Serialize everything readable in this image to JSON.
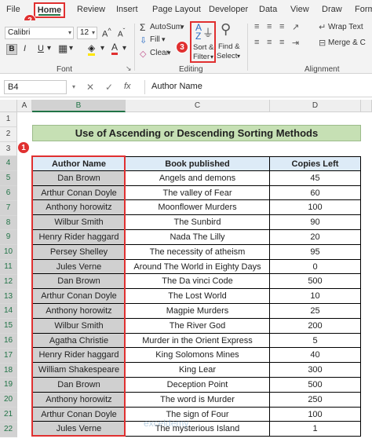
{
  "ribbon_tabs": [
    "File",
    "Home",
    "Review",
    "Insert",
    "Page Layout",
    "Developer",
    "Data",
    "View",
    "Draw",
    "Form"
  ],
  "ribbon": {
    "font_name": "Calibri",
    "font_size": "12",
    "autosum_label": "AutoSum",
    "fill_label": "Fill",
    "clear_label": "Clear",
    "sort_filter_label_1": "Sort &",
    "sort_filter_label_2": "Filter",
    "find_select_label_1": "Find &",
    "find_select_label_2": "Select",
    "wrap_text_label": "Wrap Text",
    "merge_label": "Merge & C",
    "group_font": "Font",
    "group_editing": "Editing",
    "group_alignment": "Alignment"
  },
  "badges": [
    "1",
    "2",
    "3"
  ],
  "formula_bar": {
    "name_box": "B4",
    "content": "Author Name"
  },
  "columns": [
    "A",
    "B",
    "C",
    "D"
  ],
  "rows": [
    "1",
    "2",
    "3",
    "4",
    "5",
    "6",
    "7",
    "8",
    "9",
    "10",
    "11",
    "12",
    "13",
    "14",
    "15",
    "16",
    "17",
    "18",
    "19",
    "20",
    "21",
    "22"
  ],
  "table": {
    "title": "Use of Ascending or Descending Sorting Methods",
    "headers": [
      "Author Name",
      "Book published",
      "Copies Left"
    ],
    "rows": [
      [
        "Dan Brown",
        "Angels and demons",
        "45"
      ],
      [
        "Arthur Conan Doyle",
        "The valley of Fear",
        "60"
      ],
      [
        "Anthony horowitz",
        "Moonflower Murders",
        "100"
      ],
      [
        "Wilbur Smith",
        "The Sunbird",
        "90"
      ],
      [
        "Henry Rider haggard",
        "Nada The Lilly",
        "20"
      ],
      [
        "Persey Shelley",
        "The necessity of atheism",
        "95"
      ],
      [
        "Jules Verne",
        "Around The World in Eighty Days",
        "0"
      ],
      [
        "Dan Brown",
        "The Da vinci Code",
        "500"
      ],
      [
        "Arthur Conan Doyle",
        "The Lost World",
        "10"
      ],
      [
        "Anthony horowitz",
        "Magpie Murders",
        "25"
      ],
      [
        "Wilbur Smith",
        "The River God",
        "200"
      ],
      [
        "Agatha Christie",
        "Murder in the Orient Express",
        "5"
      ],
      [
        "Henry Rider haggard",
        "King Solomons Mines",
        "40"
      ],
      [
        "William Shakespeare",
        "King Lear",
        "300"
      ],
      [
        "Dan Brown",
        "Deception Point",
        "500"
      ],
      [
        "Anthony horowitz",
        "The word is Murder",
        "250"
      ],
      [
        "Arthur Conan Doyle",
        "The sign of Four",
        "100"
      ],
      [
        "Jules Verne",
        "The mysterious Island",
        "1"
      ]
    ]
  },
  "watermark": "exceldemy"
}
